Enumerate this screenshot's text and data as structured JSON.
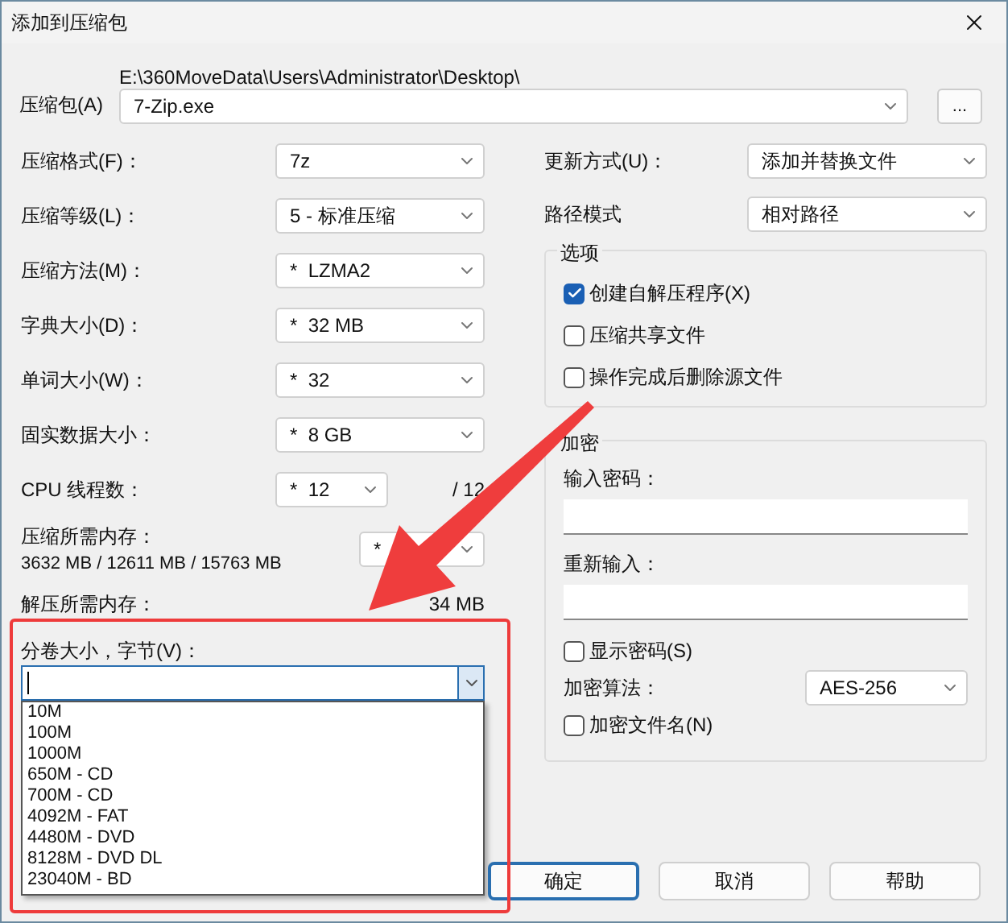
{
  "window": {
    "title": "添加到压缩包"
  },
  "archive": {
    "label": "压缩包(A)",
    "path": "E:\\360MoveData\\Users\\Administrator\\Desktop\\",
    "value": "7-Zip.exe",
    "browse": "..."
  },
  "settings": [
    {
      "label": "压缩格式(F)：",
      "value": "7z"
    },
    {
      "label": "压缩等级(L)：",
      "value": "5 - 标准压缩"
    },
    {
      "label": "压缩方法(M)：",
      "value": "*  LZMA2"
    },
    {
      "label": "字典大小(D)：",
      "value": "*  32 MB"
    },
    {
      "label": "单词大小(W)：",
      "value": "*  32"
    },
    {
      "label": "固实数据大小：",
      "value": "*  8 GB"
    }
  ],
  "threads": {
    "label": "CPU 线程数：",
    "value": "*  12",
    "max": "/ 12"
  },
  "memory": {
    "label": "压缩所需内存：",
    "usage": "3632 MB / 12611 MB / 15763 MB",
    "value": "*"
  },
  "decompress_memory": {
    "label": "解压所需内存：",
    "value": "34 MB"
  },
  "split": {
    "label": "分卷大小，字节(V)：",
    "options": [
      "10M",
      "100M",
      "1000M",
      "650M - CD",
      "700M - CD",
      "4092M - FAT",
      "4480M - DVD",
      "8128M - DVD DL",
      "23040M - BD"
    ]
  },
  "update": {
    "label": "更新方式(U)：",
    "value": "添加并替换文件"
  },
  "path_mode": {
    "label": "路径模式",
    "value": "相对路径"
  },
  "options": {
    "title": "选项",
    "items": [
      {
        "label": "创建自解压程序(X)",
        "checked": true
      },
      {
        "label": "压缩共享文件",
        "checked": false
      },
      {
        "label": "操作完成后删除源文件",
        "checked": false
      }
    ]
  },
  "encryption": {
    "title": "加密",
    "password_label": "输入密码：",
    "reenter_label": "重新输入：",
    "show_password": {
      "label": "显示密码(S)",
      "checked": false
    },
    "method_label": "加密算法：",
    "method": "AES-256",
    "encrypt_names": {
      "label": "加密文件名(N)",
      "checked": false
    }
  },
  "buttons": [
    {
      "label": "确定",
      "kind": "default"
    },
    {
      "label": "取消",
      "kind": "normal"
    },
    {
      "label": "帮助",
      "kind": "normal"
    }
  ]
}
